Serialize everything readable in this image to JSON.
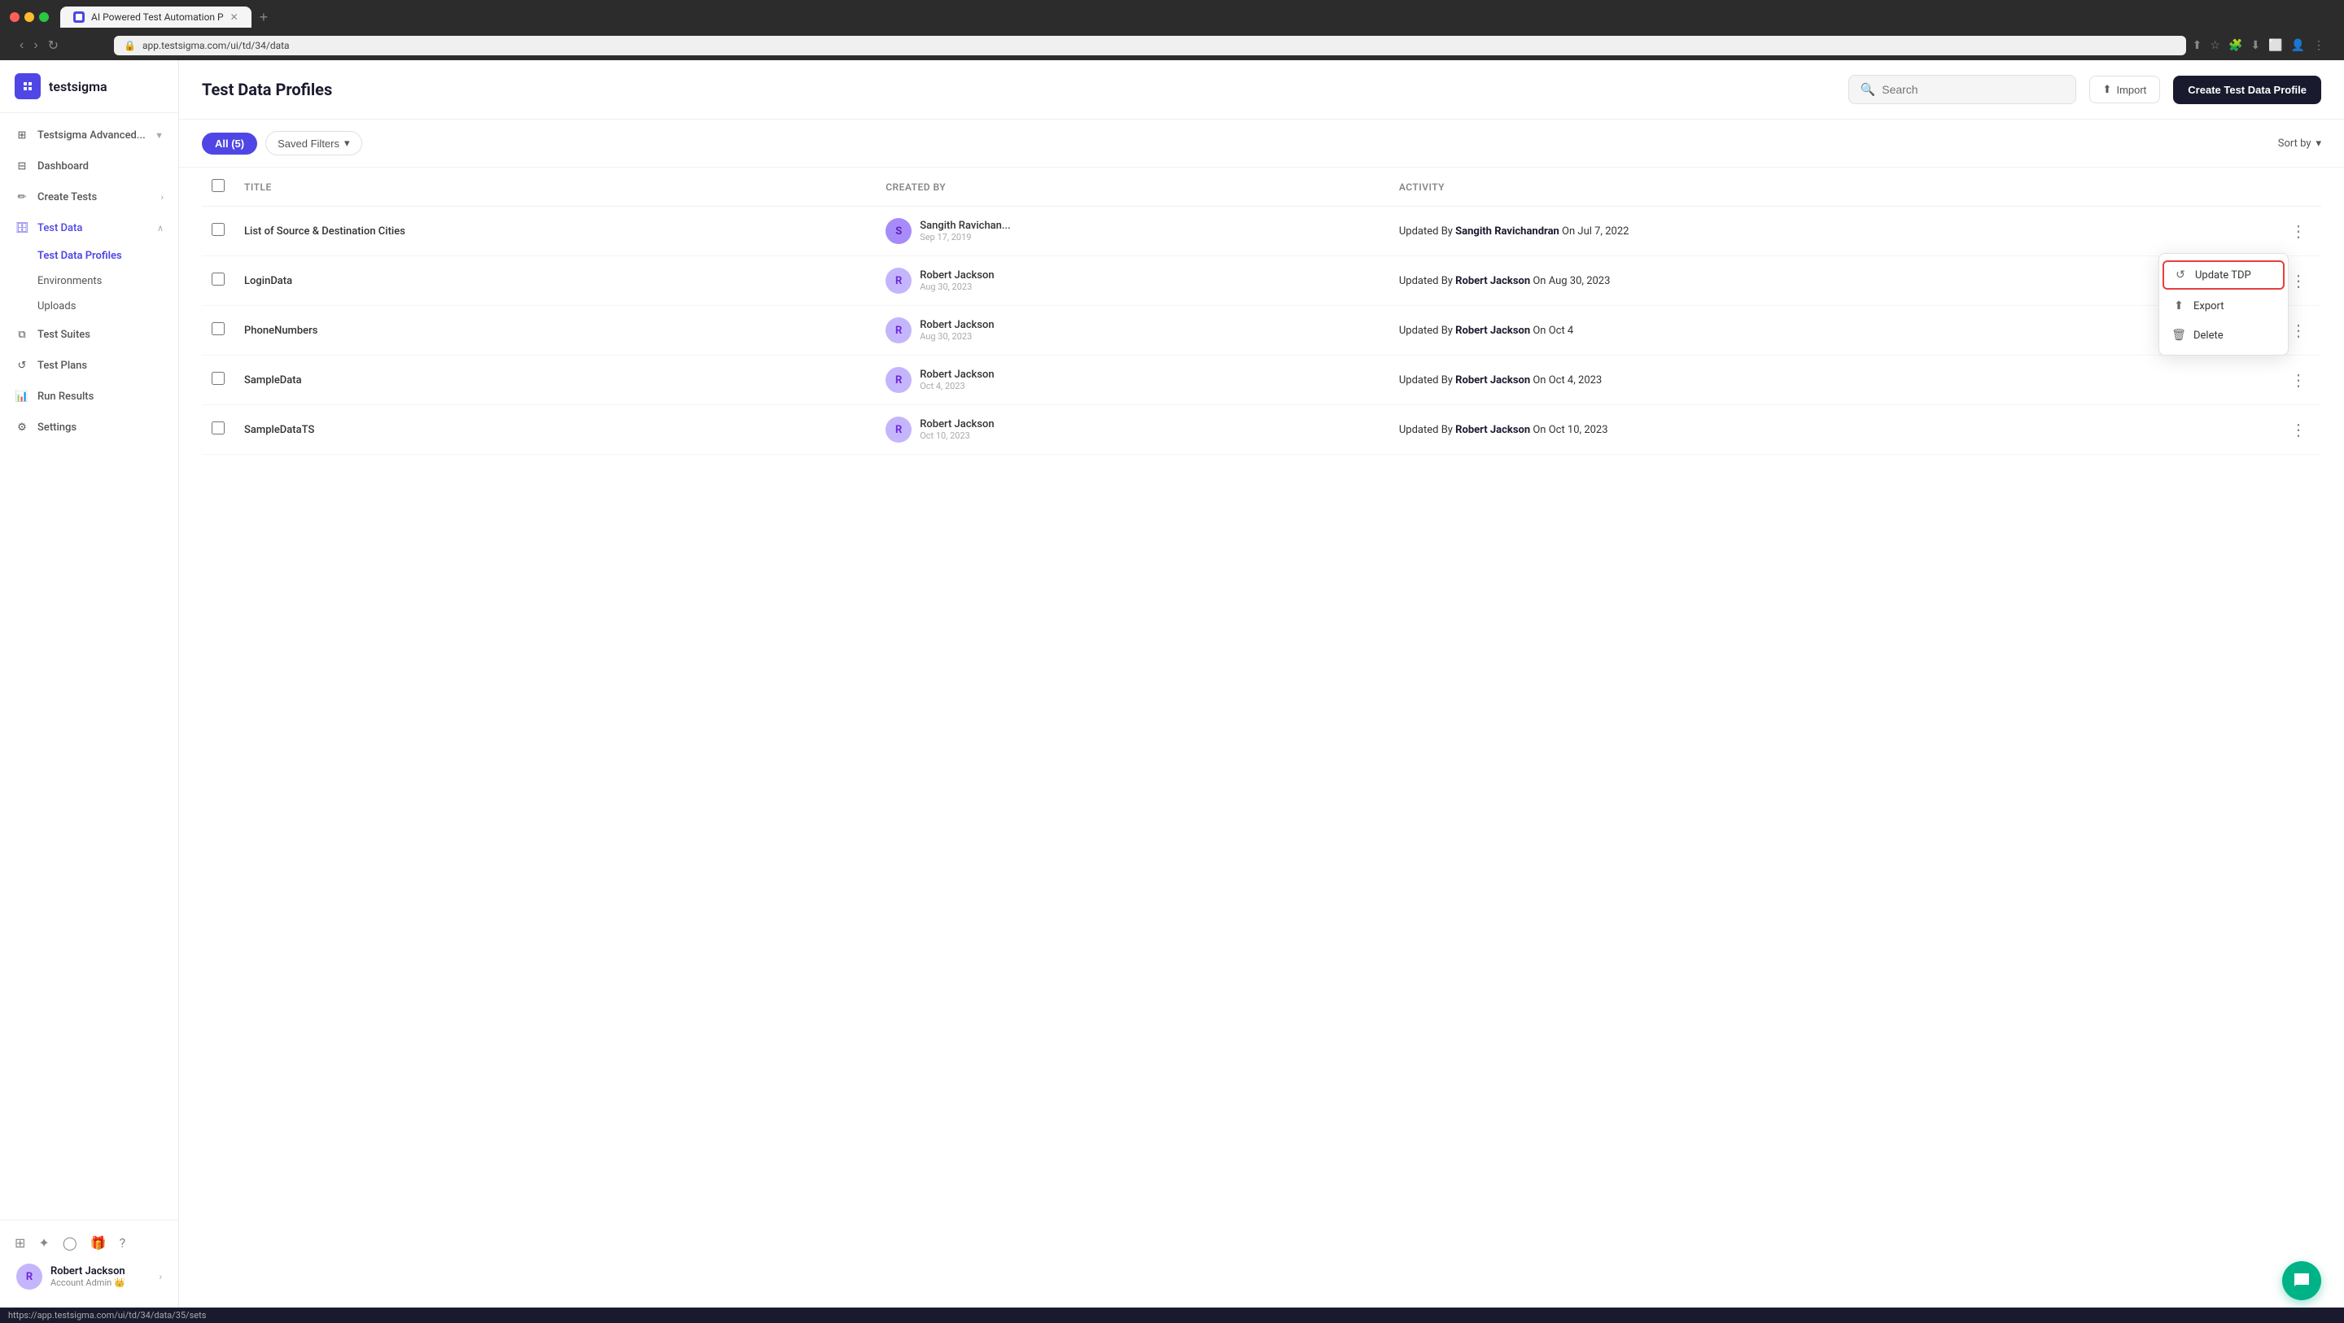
{
  "browser": {
    "url": "app.testsigma.com/ui/td/34/data",
    "tab_title": "AI Powered Test Automation P",
    "status_bar": "https://app.testsigma.com/ui/td/34/data/35/sets"
  },
  "app": {
    "logo_text": "testsigma"
  },
  "sidebar": {
    "top_label": "Testsigma Advanced...",
    "items": [
      {
        "id": "testsigma-advanced",
        "label": "Testsigma Advanced...",
        "icon": "grid"
      },
      {
        "id": "dashboard",
        "label": "Dashboard",
        "icon": "dashboard"
      },
      {
        "id": "create-tests",
        "label": "Create Tests",
        "icon": "pen",
        "has_chevron": true
      },
      {
        "id": "test-data",
        "label": "Test Data",
        "icon": "database",
        "has_chevron": true,
        "expanded": true
      },
      {
        "id": "test-suites",
        "label": "Test Suites",
        "icon": "layers"
      },
      {
        "id": "test-plans",
        "label": "Test Plans",
        "icon": "refresh"
      },
      {
        "id": "run-results",
        "label": "Run Results",
        "icon": "bar-chart"
      },
      {
        "id": "settings",
        "label": "Settings",
        "icon": "gear"
      }
    ],
    "sub_items": [
      {
        "id": "test-data-profiles",
        "label": "Test Data Profiles",
        "active": true
      },
      {
        "id": "environments",
        "label": "Environments"
      },
      {
        "id": "uploads",
        "label": "Uploads"
      }
    ],
    "bottom_icons": [
      "grid2",
      "star",
      "circle",
      "gift",
      "question"
    ],
    "user": {
      "name": "Robert Jackson",
      "role": "Account Admin",
      "initials": "R",
      "emoji": "👑"
    }
  },
  "header": {
    "title": "Test Data Profiles",
    "search_placeholder": "Search",
    "import_label": "Import",
    "create_label": "Create Test Data Profile"
  },
  "toolbar": {
    "all_label": "All (5)",
    "saved_filters_label": "Saved Filters",
    "sort_by_label": "Sort by"
  },
  "table": {
    "columns": [
      "",
      "Title",
      "Created by",
      "Activity",
      ""
    ],
    "rows": [
      {
        "id": 1,
        "title": "List of Source & Destination Cities",
        "creator_name": "Sangith Ravichan...",
        "creator_date": "Sep 17, 2019",
        "creator_initials": "S",
        "activity": "Updated By Sangith Ravichandran On Jul 7, 2022",
        "activity_bold": "Sangith Ravichandran"
      },
      {
        "id": 2,
        "title": "LoginData",
        "creator_name": "Robert Jackson",
        "creator_date": "Aug 30, 2023",
        "creator_initials": "R",
        "activity": "Updated By Robert Jackson On Aug 30, 2023",
        "activity_bold": "Robert Jackson",
        "menu_open": true
      },
      {
        "id": 3,
        "title": "PhoneNumbers",
        "creator_name": "Robert Jackson",
        "creator_date": "Aug 30, 2023",
        "creator_initials": "R",
        "activity": "Updated By Robert Jackson On Oct 4",
        "activity_bold": "Robert Jackson"
      },
      {
        "id": 4,
        "title": "SampleData",
        "creator_name": "Robert Jackson",
        "creator_date": "Oct 4, 2023",
        "creator_initials": "R",
        "activity": "Updated By Robert Jackson On Oct 4, 2023",
        "activity_bold": "Robert Jackson"
      },
      {
        "id": 5,
        "title": "SampleDataTS",
        "creator_name": "Robert Jackson",
        "creator_date": "Oct 10, 2023",
        "creator_initials": "R",
        "activity": "Updated By Robert Jackson On Oct 10, 2023",
        "activity_bold": "Robert Jackson"
      }
    ]
  },
  "context_menu": {
    "items": [
      {
        "id": "update-tdp",
        "label": "Update TDP",
        "icon": "refresh",
        "highlighted": true
      },
      {
        "id": "export",
        "label": "Export",
        "icon": "export"
      },
      {
        "id": "delete",
        "label": "Delete",
        "icon": "trash"
      }
    ]
  }
}
